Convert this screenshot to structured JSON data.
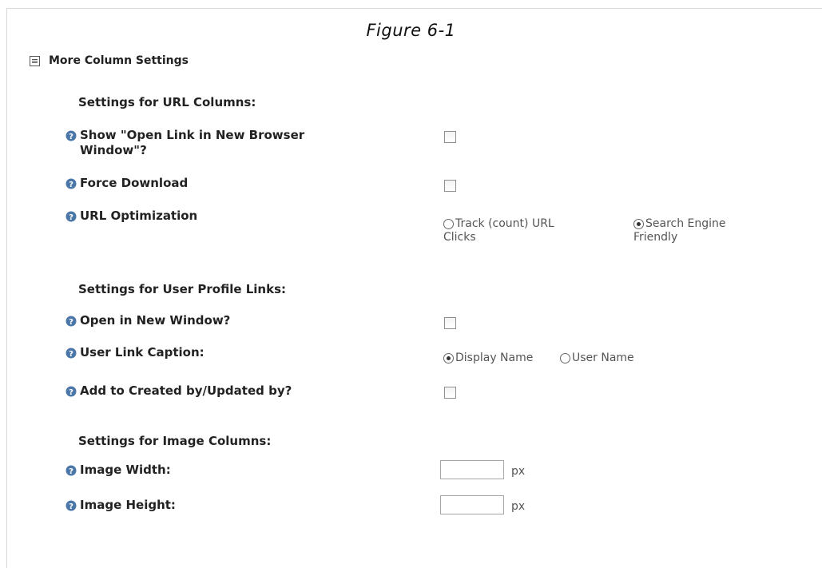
{
  "figure_caption": "Figure 6-1",
  "section": {
    "title": "More Column Settings",
    "icon": "collapse-icon"
  },
  "url_columns": {
    "heading": "Settings for URL Columns:",
    "open_link_label_line1": "Show \"Open Link in New Browser",
    "open_link_label_line2": "Window\"?",
    "force_download_label": "Force Download",
    "url_optimization_label": "URL Optimization",
    "optimization_options": [
      {
        "label_line1": "Track (count) URL",
        "label_line2": "Clicks",
        "selected": false
      },
      {
        "label_line1": "Search Engine",
        "label_line2": "Friendly",
        "selected": true
      }
    ]
  },
  "profile_links": {
    "heading": "Settings for User Profile Links:",
    "open_new_window_label": "Open in New Window?",
    "user_link_caption_label": "User Link Caption:",
    "caption_options": [
      {
        "label": "Display Name",
        "selected": true
      },
      {
        "label": "User Name",
        "selected": false
      }
    ],
    "add_to_created_label": "Add to Created by/Updated by?"
  },
  "image_columns": {
    "heading": "Settings for Image Columns:",
    "width_label": "Image Width:",
    "height_label": "Image Height:",
    "width_value": "",
    "height_value": "",
    "unit": "px"
  },
  "icons": {
    "help": "help-icon"
  },
  "colors": {
    "help_icon": "#4a76a8",
    "text": "#222222"
  }
}
